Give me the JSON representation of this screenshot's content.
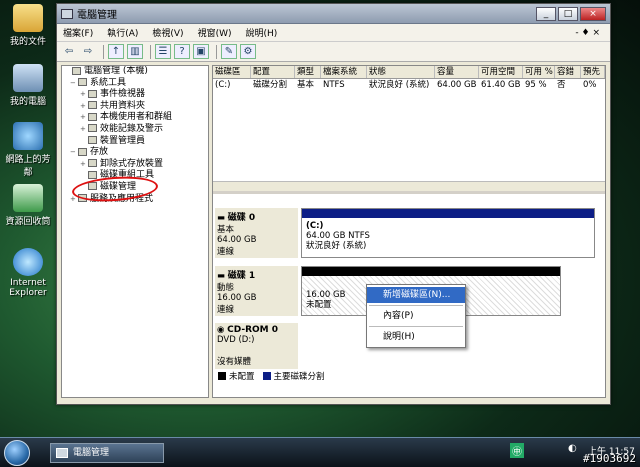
{
  "desktop": {
    "icons": [
      {
        "label": "我的文件",
        "icon": "folder-icon"
      },
      {
        "label": "我的電腦",
        "icon": "computer-icon"
      },
      {
        "label": "網路上的芳鄰",
        "icon": "network-icon"
      },
      {
        "label": "資源回收筒",
        "icon": "recycle-bin-icon"
      },
      {
        "label": "Internet Explorer",
        "icon": "ie-icon"
      }
    ]
  },
  "window": {
    "title": "電腦管理",
    "menu": [
      "檔案(F)",
      "執行(A)",
      "檢視(V)",
      "視窗(W)",
      "說明(H)"
    ],
    "menu_right": "- ♦ ×"
  },
  "tree": [
    {
      "indent": 0,
      "exp": "",
      "label": "電腦管理 (本機)"
    },
    {
      "indent": 1,
      "exp": "−",
      "label": "系統工具"
    },
    {
      "indent": 2,
      "exp": "+",
      "label": "事件檢視器"
    },
    {
      "indent": 2,
      "exp": "+",
      "label": "共用資料夾"
    },
    {
      "indent": 2,
      "exp": "+",
      "label": "本機使用者和群組"
    },
    {
      "indent": 2,
      "exp": "+",
      "label": "效能記錄及警示"
    },
    {
      "indent": 2,
      "exp": "",
      "label": "裝置管理員"
    },
    {
      "indent": 1,
      "exp": "−",
      "label": "存放"
    },
    {
      "indent": 2,
      "exp": "+",
      "label": "卸除式存放裝置"
    },
    {
      "indent": 2,
      "exp": "",
      "label": "磁碟重組工具"
    },
    {
      "indent": 2,
      "exp": "",
      "label": "磁碟管理"
    },
    {
      "indent": 1,
      "exp": "+",
      "label": "服務及應用程式"
    }
  ],
  "volume_table": {
    "headers": [
      "磁碟區",
      "配置",
      "類型",
      "檔案系統",
      "狀態",
      "容量",
      "可用空間",
      "可用 %",
      "容錯",
      "預先"
    ],
    "rows": [
      [
        "(C:)",
        "磁碟分割",
        "基本",
        "NTFS",
        "狀況良好 (系統)",
        "64.00 GB",
        "61.40 GB",
        "95 %",
        "否",
        "0%"
      ]
    ]
  },
  "disks": [
    {
      "name": "磁碟 0",
      "type": "基本",
      "size": "64.00 GB",
      "status": "連線",
      "partition": {
        "label": "(C:)",
        "info": "64.00 GB NTFS",
        "state": "狀況良好 (系統)"
      }
    },
    {
      "name": "磁碟 1",
      "type": "動態",
      "size": "16.00 GB",
      "status": "連線",
      "partition": {
        "label": "",
        "info": "16.00 GB",
        "state": "未配置"
      }
    },
    {
      "name": "CD-ROM 0",
      "type": "DVD (D:)",
      "size": "",
      "status": "沒有媒體"
    }
  ],
  "legend": {
    "unallocated": "未配置",
    "primary": "主要磁碟分割"
  },
  "context_menu": [
    "新增磁碟區(N)...",
    "內容(P)",
    "說明(H)"
  ],
  "taskbar": {
    "task": "電腦管理",
    "clock": "上午 11:57"
  },
  "watermark": "#1903692",
  "colors": {
    "primary_partition": "#0c1e86",
    "highlight": "#316ac5",
    "annotation": "#dd1111"
  }
}
